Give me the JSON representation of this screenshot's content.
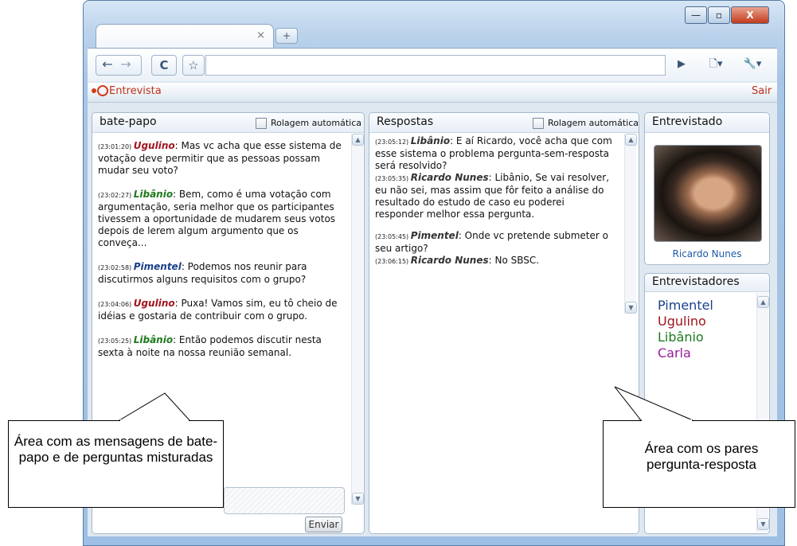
{
  "browser": {
    "tab_close": "×",
    "new_tab": "+",
    "nav": {
      "back": "←",
      "forward": "→",
      "reload": "C",
      "star": "☆"
    },
    "menu": {
      "play": "▶",
      "page": "🗋▾",
      "wrench": "🔧▾"
    },
    "window_controls": {
      "minimize": "—",
      "maximize": "▫",
      "close": "X"
    }
  },
  "app": {
    "title": "Entrevista",
    "logout": "Sair"
  },
  "chat": {
    "title": "bate-papo",
    "autoscroll_label": "Rolagem automática",
    "messages": [
      {
        "time": "(23:01:20)",
        "name": "Ugulino",
        "color": "#a0141e",
        "text": ": Mas vc acha que esse sistema de votação deve permitir que as pessoas possam mudar seu voto?"
      },
      {
        "time": "(23:02:27)",
        "name": "Libânio",
        "color": "#1e7a1e",
        "text": ": Bem, como é uma votação com argumentação, seria melhor que os participantes tivessem a oportunidade de mudarem seus votos depois de lerem algum argumento que os conveça..."
      },
      {
        "time": "(23:02:58)",
        "name": "Pimentel",
        "color": "#1a3f8a",
        "text": ": Podemos nos reunir para discutirmos alguns requisitos com o grupo?"
      },
      {
        "time": "(23:04:06)",
        "name": "Ugulino",
        "color": "#a0141e",
        "text": ": Puxa! Vamos sim, eu tô cheio de idéias e gostaria de contribuir com o grupo."
      },
      {
        "time": "(23:05:25)",
        "name": "Libânio",
        "color": "#1e7a1e",
        "text": ": Então podemos discutir nesta sexta à noite na nossa reunião semanal."
      }
    ],
    "send_label": "Enviar"
  },
  "answers": {
    "title": "Respostas",
    "autoscroll_label": "Rolagem automática",
    "messages": [
      {
        "time": "(23:05:12)",
        "name": "Libânio",
        "text": ": E aí Ricardo, você acha que com esse sistema o problema pergunta-sem-resposta será resolvido?",
        "gap": false
      },
      {
        "time": "(23:05:35)",
        "name": "Ricardo Nunes",
        "text": ": Libânio, Se vai resolver, eu não sei, mas assim que fôr feito a análise do resultado do estudo de caso eu poderei responder melhor essa pergunta.",
        "gap": true
      },
      {
        "time": "(23:05:45)",
        "name": "Pimentel",
        "text": ": Onde vc pretende submeter o seu artigo?",
        "gap": false
      },
      {
        "time": "(23:06:15)",
        "name": "Ricardo Nunes",
        "text": ": No SBSC.",
        "gap": false
      }
    ]
  },
  "interviewee": {
    "title": "Entrevistado",
    "name": "Ricardo Nunes"
  },
  "interviewers": {
    "title": "Entrevistadores",
    "people": [
      {
        "name": "Pimentel",
        "color": "#1a3f8a"
      },
      {
        "name": "Ugulino",
        "color": "#a0141e"
      },
      {
        "name": "Libânio",
        "color": "#1e7a1e"
      },
      {
        "name": "Carla",
        "color": "#9a1e9a"
      }
    ]
  },
  "callouts": {
    "left": "Área com as mensagens de bate-papo e de perguntas misturadas",
    "right": "Área com os pares pergunta-resposta"
  }
}
